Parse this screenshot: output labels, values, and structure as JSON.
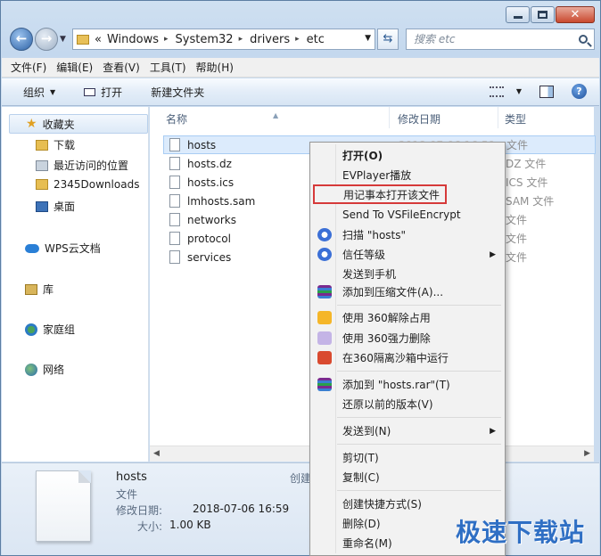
{
  "address": {
    "crumbs": [
      "Windows",
      "System32",
      "drivers",
      "etc"
    ],
    "overflow": "«"
  },
  "search": {
    "placeholder": "搜索 etc"
  },
  "menubar": [
    "文件(F)",
    "编辑(E)",
    "查看(V)",
    "工具(T)",
    "帮助(H)"
  ],
  "toolbar": {
    "organize": "组织",
    "open": "打开",
    "new_folder": "新建文件夹"
  },
  "navpane": {
    "favorites": "收藏夹",
    "fav_items": [
      "下载",
      "最近访问的位置",
      "2345Downloads",
      "桌面"
    ],
    "wps": "WPS云文档",
    "library": "库",
    "homegroup": "家庭组",
    "network": "网络"
  },
  "columns": {
    "name": "名称",
    "date": "修改日期",
    "type": "类型"
  },
  "files": [
    {
      "name": "hosts",
      "date": "2018-07-06 16:59",
      "type": "文件"
    },
    {
      "name": "hosts.dz",
      "date": "",
      "type": "DZ 文件"
    },
    {
      "name": "hosts.ics",
      "date": "",
      "type": "ICS 文件"
    },
    {
      "name": "lmhosts.sam",
      "date": "",
      "type": "SAM 文件"
    },
    {
      "name": "networks",
      "date": "",
      "type": "文件"
    },
    {
      "name": "protocol",
      "date": "",
      "type": "文件"
    },
    {
      "name": "services",
      "date": "",
      "type": "文件"
    }
  ],
  "details": {
    "name": "hosts",
    "kind": "文件",
    "date_label": "修改日期:",
    "date_value": "2018-07-06 16:59",
    "size_label": "大小:",
    "size_value": "1.00 KB",
    "created_label": "创建"
  },
  "context_menu": {
    "open": "打开(O)",
    "evplayer": "EVPlayer播放",
    "notepad": "用记事本打开该文件",
    "vsfile": "Send To VSFileEncrypt",
    "scan": "扫描 \"hosts\"",
    "trust": "信任等级",
    "send_phone": "发送到手机",
    "add_archive": "添加到压缩文件(A)...",
    "unlock360": "使用 360解除占用",
    "delete360": "使用 360强力删除",
    "sandbox360": "在360隔离沙箱中运行",
    "add_rar": "添加到 \"hosts.rar\"(T)",
    "restore": "还原以前的版本(V)",
    "send_to": "发送到(N)",
    "cut": "剪切(T)",
    "copy": "复制(C)",
    "shortcut": "创建快捷方式(S)",
    "delete": "删除(D)",
    "rename": "重命名(M)"
  },
  "watermark": "极速下载站"
}
